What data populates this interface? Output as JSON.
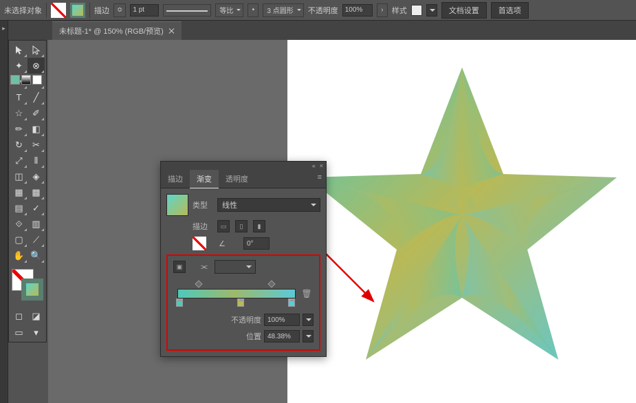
{
  "topbar": {
    "selection": "未选择对象",
    "stroke_label": "描边",
    "stroke_value": "1 pt",
    "uniform_label": "等比",
    "brush_label": "3 点圆形",
    "opacity_label": "不透明度",
    "opacity_value": "100%",
    "style_label": "样式",
    "doc_setup": "文档设置",
    "prefs": "首选项"
  },
  "tab": {
    "title": "未标题-1* @ 150% (RGB/预览)"
  },
  "panel": {
    "tabs": {
      "stroke": "描边",
      "gradient": "渐变",
      "transparency": "透明度"
    },
    "type_label": "类型",
    "type_value": "线性",
    "stroke_label": "描边",
    "angle_value": "0°",
    "opacity_label": "不透明度",
    "opacity_value": "100%",
    "position_label": "位置",
    "position_value": "48.38%"
  }
}
